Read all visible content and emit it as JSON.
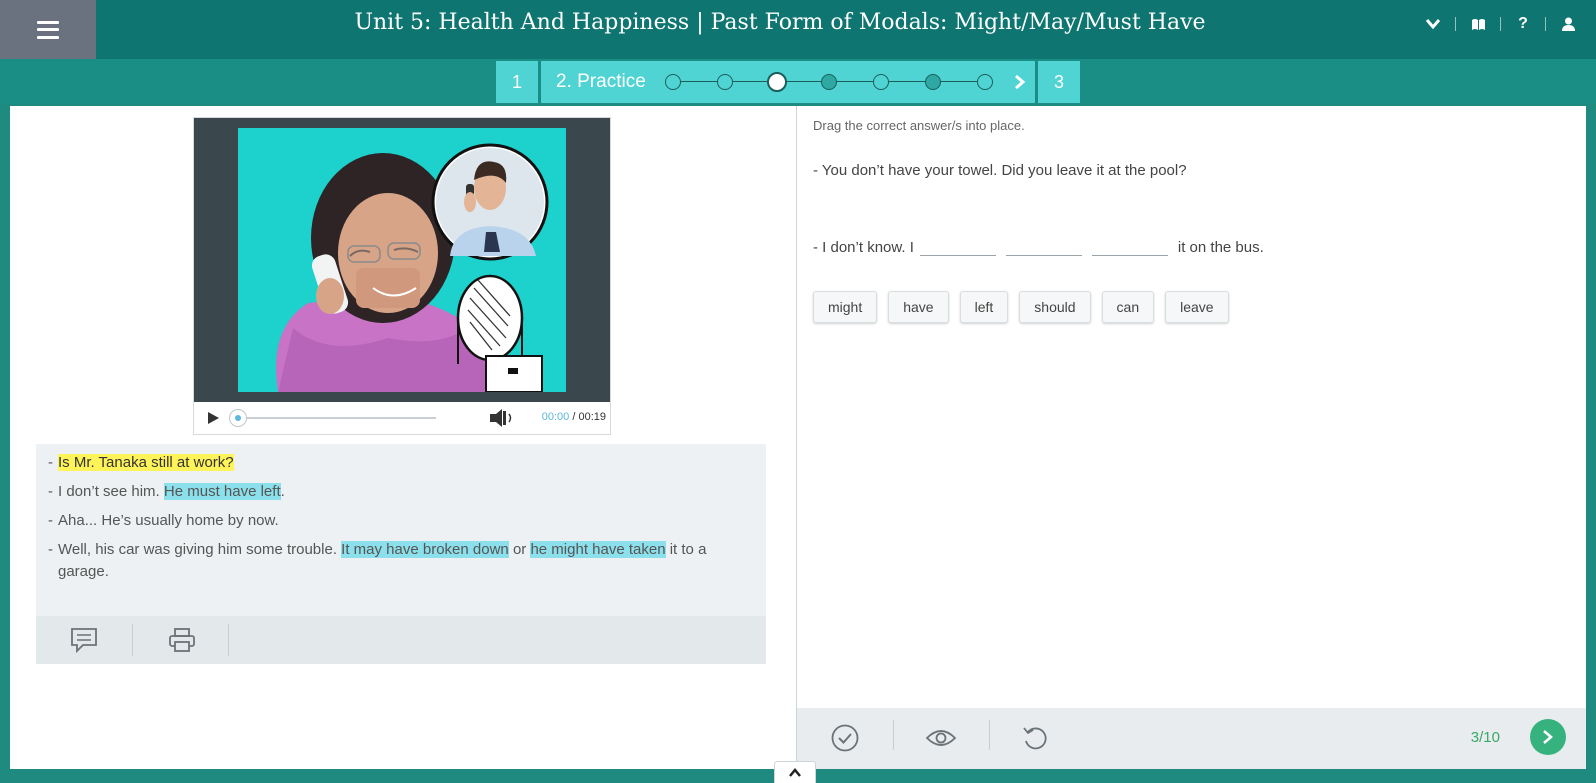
{
  "header": {
    "title": "Unit 5: Health And Happiness | Past Form of Modals: Might/May/Must Have",
    "icons": [
      "menu-icon",
      "chevron-down-icon",
      "book-icon",
      "help-icon",
      "user-icon"
    ],
    "help_glyph": "?"
  },
  "steps": {
    "step1": "1",
    "step2": "2. Practice",
    "step3": "3",
    "progress": {
      "total": 7,
      "completed": [
        4,
        6
      ],
      "current": 3
    }
  },
  "media": {
    "time_current": "00:00",
    "time_separator": "/",
    "time_total": "00:19",
    "progress": 0
  },
  "transcript": {
    "lines": [
      {
        "dash": "-",
        "highlight": "Is Mr. Tanaka still at work?"
      },
      {
        "dash": "-",
        "before": "I don’t see him.",
        "highlight": "He must have left",
        "after": "."
      },
      {
        "dash": "-",
        "text": "Aha... He’s usually home by now."
      },
      {
        "dash": "-",
        "before": "Well, his car was giving him some trouble.",
        "highlight1": "It may have broken down",
        "middle": "or",
        "highlight2": "he might have taken",
        "after": "it to a garage."
      }
    ]
  },
  "exercise": {
    "instruction": "Drag the correct answer/s into place.",
    "question1": "- You don’t have your towel. Did you leave it at the pool?",
    "question2_before": "- I don’t know. I",
    "question2_after": "it on the bus.",
    "options": [
      "might",
      "have",
      "left",
      "should",
      "can",
      "leave"
    ],
    "counter": "3/10"
  },
  "colors": {
    "header_bg": "#0e7570",
    "step_bg": "#4fd3d3",
    "highlight_yellow": "#fff35a",
    "highlight_blue": "#8ce0eb",
    "accent_green": "#36b27e"
  }
}
